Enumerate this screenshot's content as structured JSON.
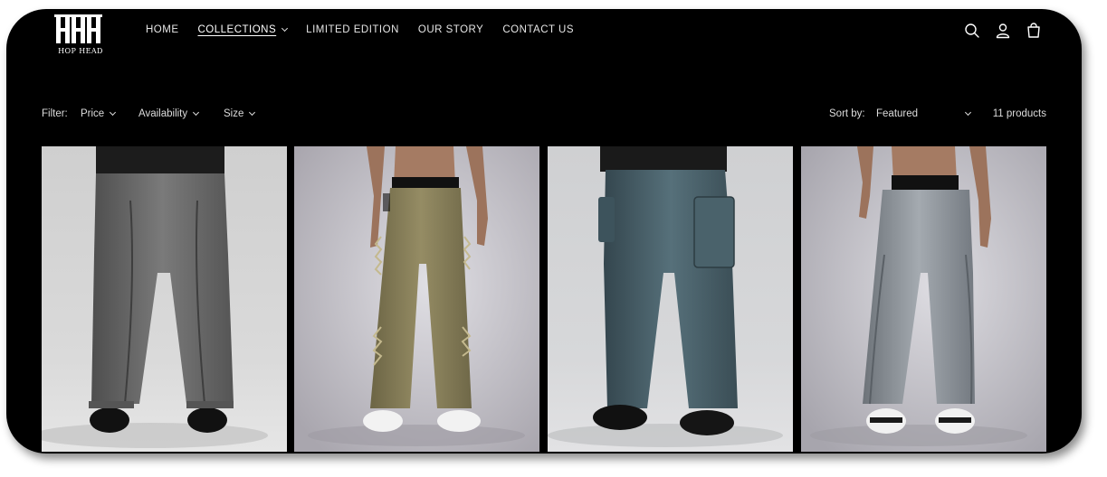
{
  "brand": {
    "name": "HOP HEAD",
    "logo_icon": "triple-h-logo"
  },
  "nav": {
    "items": [
      {
        "label": "HOME",
        "has_dropdown": false,
        "active": false
      },
      {
        "label": "COLLECTIONS",
        "has_dropdown": true,
        "active": true
      },
      {
        "label": "LIMITED EDITION",
        "has_dropdown": false,
        "active": false
      },
      {
        "label": "OUR STORY",
        "has_dropdown": false,
        "active": false
      },
      {
        "label": "CONTACT US",
        "has_dropdown": false,
        "active": false
      }
    ]
  },
  "header_icons": [
    "search-icon",
    "account-icon",
    "cart-icon"
  ],
  "filters": {
    "label": "Filter:",
    "options": [
      "Price",
      "Availability",
      "Size"
    ]
  },
  "sort": {
    "label": "Sort by:",
    "value": "Featured"
  },
  "product_count": "11 products",
  "products": [
    {
      "image": "grey-washed-wide-leg-jeans",
      "pant_color": "#6e6e6e",
      "bg": "#d4d4d4"
    },
    {
      "image": "olive-distressed-cargo-pants",
      "pant_color": "#857d58",
      "bg": "#c9c6cc"
    },
    {
      "image": "teal-blue-cargo-jeans",
      "pant_color": "#4a5e66",
      "bg": "#d0d1d3"
    },
    {
      "image": "grey-acid-wash-jeans",
      "pant_color": "#8e949a",
      "bg": "#cbcacf"
    }
  ],
  "colors": {
    "background": "#000000",
    "text": "#e6e6e6"
  }
}
